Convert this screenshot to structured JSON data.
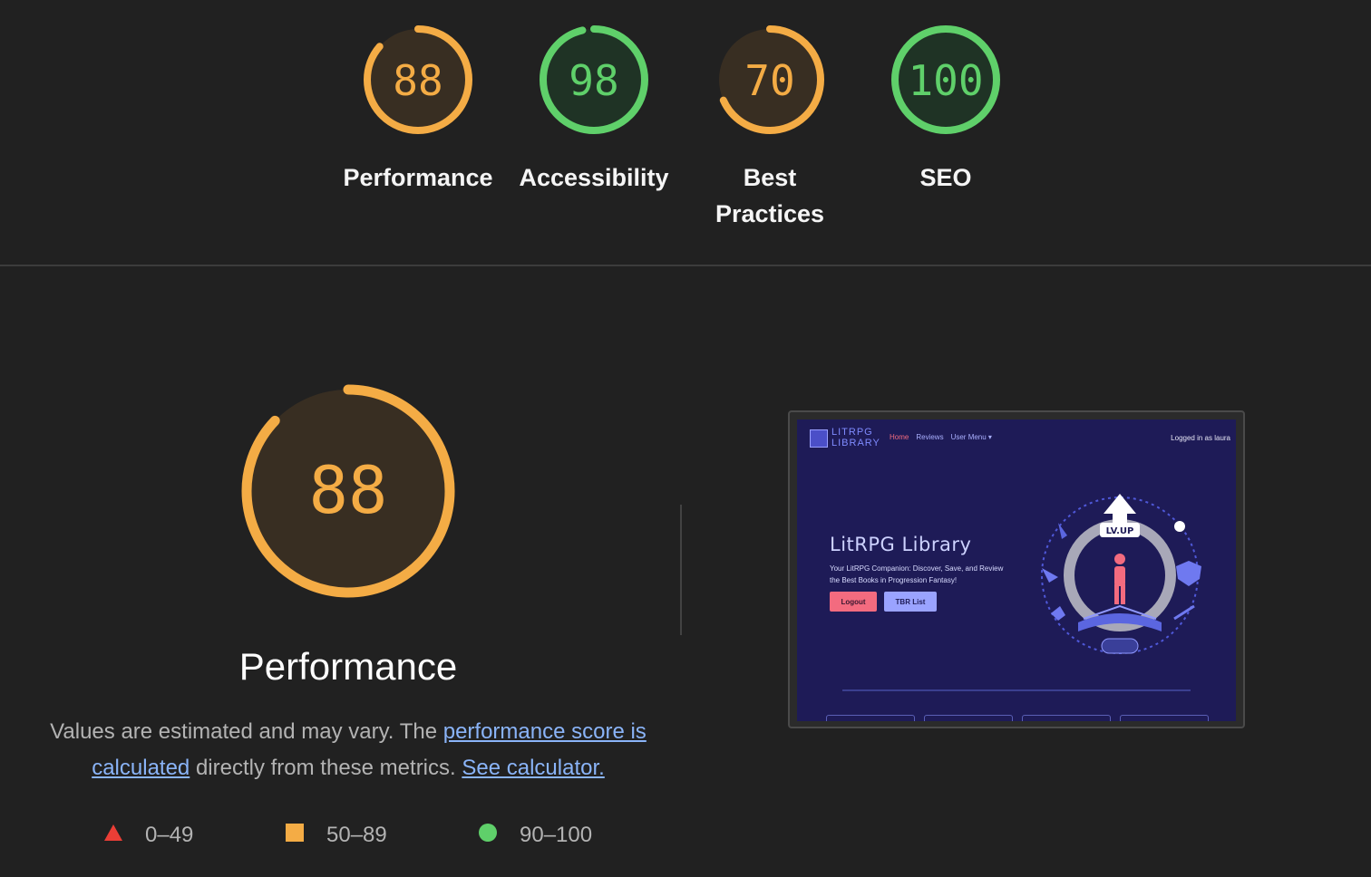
{
  "colors": {
    "average": "#f4ac45",
    "pass": "#5fd06a",
    "fail": "#eb3e36",
    "average_bg": "#382e22",
    "pass_bg": "#1f3325"
  },
  "categories": [
    {
      "id": "performance",
      "score": "88",
      "value": 88,
      "label": "Performance",
      "rating": "average"
    },
    {
      "id": "accessibility",
      "score": "98",
      "value": 98,
      "label": "Accessibility",
      "rating": "pass"
    },
    {
      "id": "best-practices",
      "score": "70",
      "value": 70,
      "label": "Best Practices",
      "rating": "average"
    },
    {
      "id": "seo",
      "score": "100",
      "value": 100,
      "label": "SEO",
      "rating": "pass"
    }
  ],
  "performance_detail": {
    "score": "88",
    "value": 88,
    "title": "Performance",
    "desc_text_1": "Values are estimated and may vary. The ",
    "desc_link_1": "performance score is calculated",
    "desc_text_2": " directly from these metrics. ",
    "desc_link_2": "See calculator."
  },
  "legend": [
    {
      "range": "0–49",
      "shape": "triangle",
      "color": "#eb3e36"
    },
    {
      "range": "50–89",
      "shape": "square",
      "color": "#f4ac45"
    },
    {
      "range": "90–100",
      "shape": "circle",
      "color": "#5fd06a"
    }
  ],
  "screenshot": {
    "logo_line1": "LITRPG",
    "logo_line2": "LIBRARY",
    "nav_home": "Home",
    "nav_reviews": "Reviews",
    "nav_user_menu": "User Menu ▾",
    "logged_in": "Logged in as laura",
    "hero_title": "LitRPG Library",
    "hero_subtitle": "Your LitRPG Companion: Discover, Save, and Review the Best Books in Progression Fantasy!",
    "btn_logout": "Logout",
    "btn_tbr": "TBR List",
    "badge_text": "LV.UP"
  }
}
